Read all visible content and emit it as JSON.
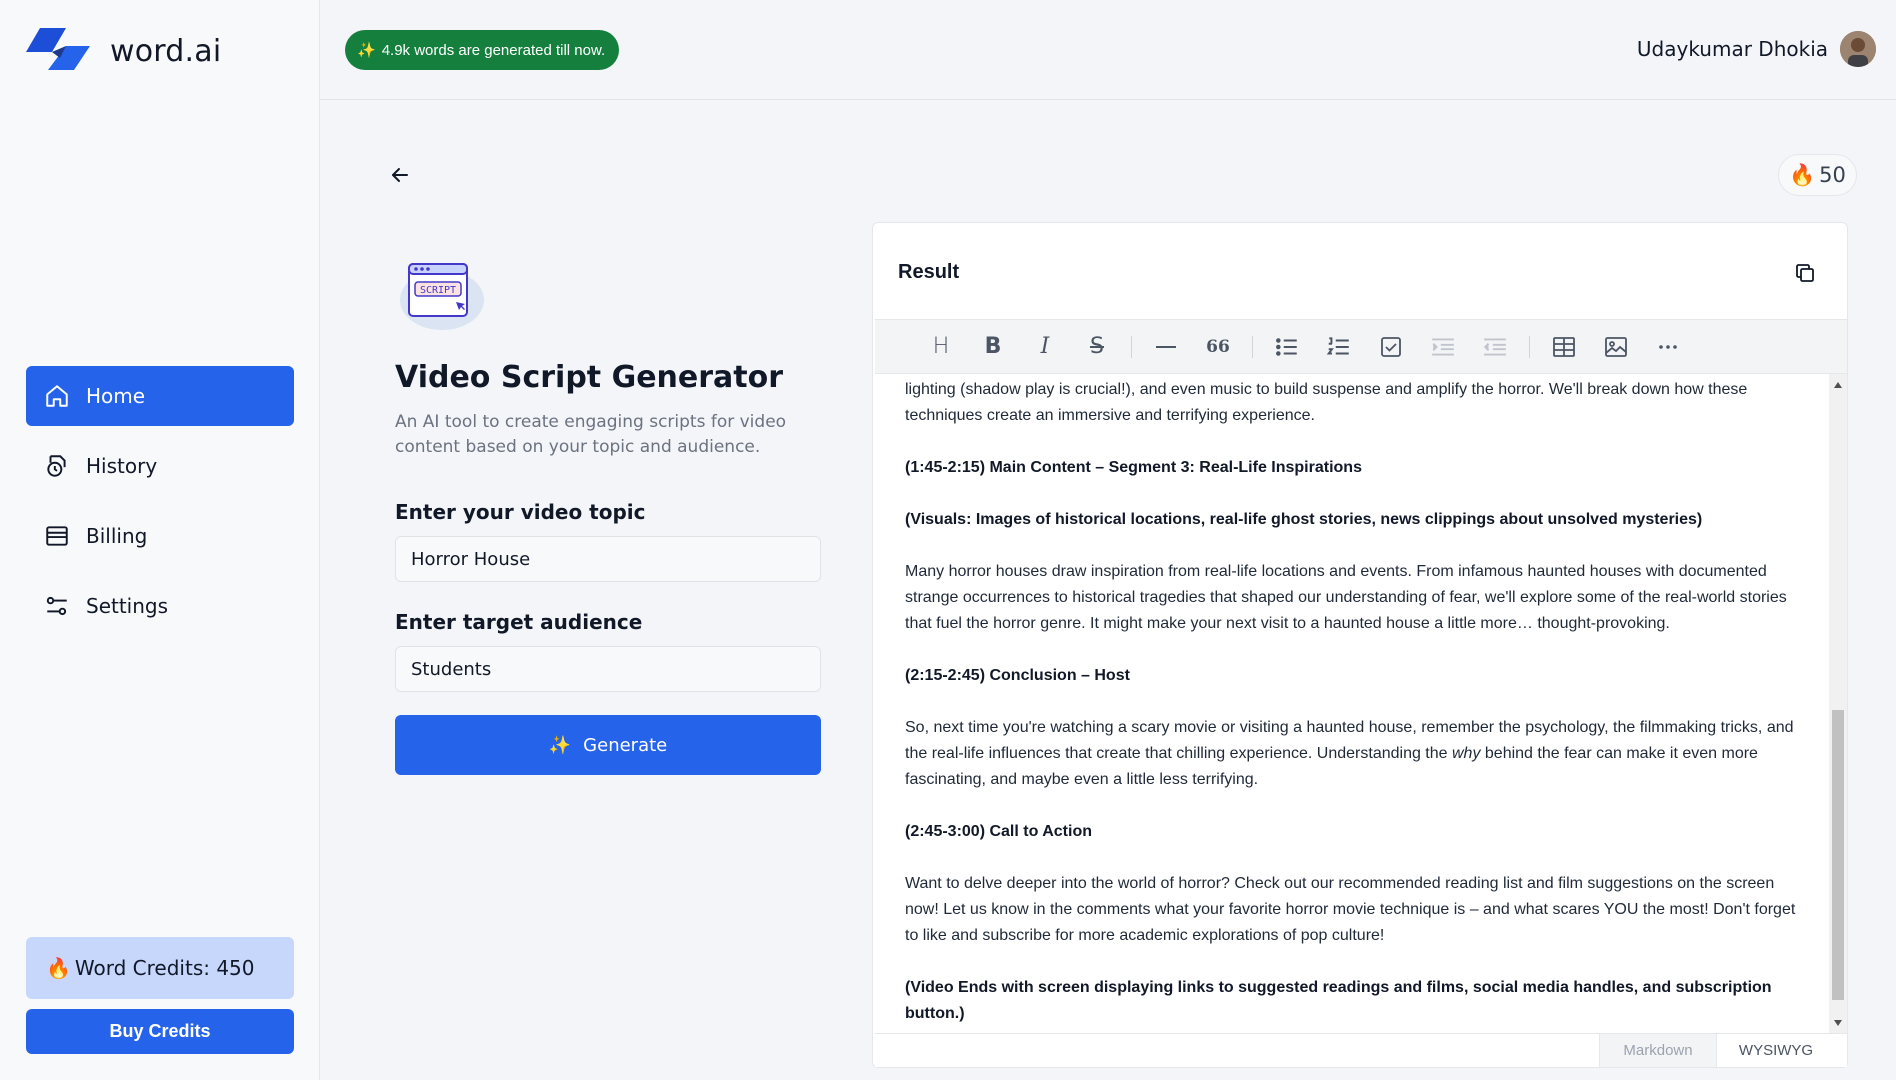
{
  "brand": {
    "name": "word.ai"
  },
  "header": {
    "badge_text": "4.9k words are generated till now.",
    "user_name": "Udaykumar Dhokia"
  },
  "sidebar": {
    "items": [
      {
        "label": "Home",
        "icon": "home-icon",
        "active": true
      },
      {
        "label": "History",
        "icon": "history-icon",
        "active": false
      },
      {
        "label": "Billing",
        "icon": "billing-icon",
        "active": false
      },
      {
        "label": "Settings",
        "icon": "settings-icon",
        "active": false
      }
    ],
    "credits_text": "Word Credits: 450",
    "buy_label": "Buy Credits"
  },
  "tool": {
    "icon_text": "SCRIPT",
    "title": "Video Script Generator",
    "description": "An AI tool to create engaging scripts for video content based on your topic and audience.",
    "topic_label": "Enter your video topic",
    "topic_value": "Horror House",
    "audience_label": "Enter target audience",
    "audience_value": "Students",
    "generate_label": "Generate"
  },
  "fire_count": "50",
  "result": {
    "title": "Result",
    "paragraphs": [
      {
        "text": "lighting (shadow play is crucial!), and even music to build suspense and amplify the horror.  We'll break down how these techniques create an immersive and terrifying experience.",
        "bold": false
      },
      {
        "text": "(1:45-2:15) Main Content – Segment 3: Real-Life Inspirations",
        "bold": true
      },
      {
        "text": "(Visuals: Images of historical locations, real-life ghost stories, news clippings about unsolved mysteries)",
        "bold": true
      },
      {
        "text": "Many horror houses draw inspiration from real-life locations and events.  From infamous haunted houses with documented strange occurrences to historical tragedies that shaped our understanding of fear, we'll explore some of the real-world stories that fuel the horror genre.  It might make your next visit to a haunted house a little more… thought-provoking.",
        "bold": false
      },
      {
        "text": "(2:15-2:45) Conclusion – Host",
        "bold": true
      },
      {
        "text_before": "So, next time you're watching a scary movie or visiting a haunted house, remember the psychology, the filmmaking tricks, and the real-life influences that create that chilling experience.  Understanding the ",
        "italic": "why",
        "text_after": " behind the fear can make it even more fascinating, and maybe even a little less terrifying.",
        "bold": false
      },
      {
        "text": "(2:45-3:00) Call to Action",
        "bold": true
      },
      {
        "text": "Want to delve deeper into the world of horror?  Check out our recommended reading list and film suggestions on the screen now!  Let us know in the comments what your favorite horror movie technique is – and what scares YOU the most!  Don't forget to like and subscribe for more academic explorations of pop culture!",
        "bold": false
      },
      {
        "text": "(Video Ends with screen displaying links to suggested readings and films, social media handles, and subscription button.)",
        "bold": true
      }
    ],
    "mode_markdown": "Markdown",
    "mode_wysiwyg": "WYSIWYG"
  },
  "toolbar": {
    "heading": "H",
    "bold": "B",
    "italic": "I",
    "strike": "S",
    "quote": "66"
  }
}
